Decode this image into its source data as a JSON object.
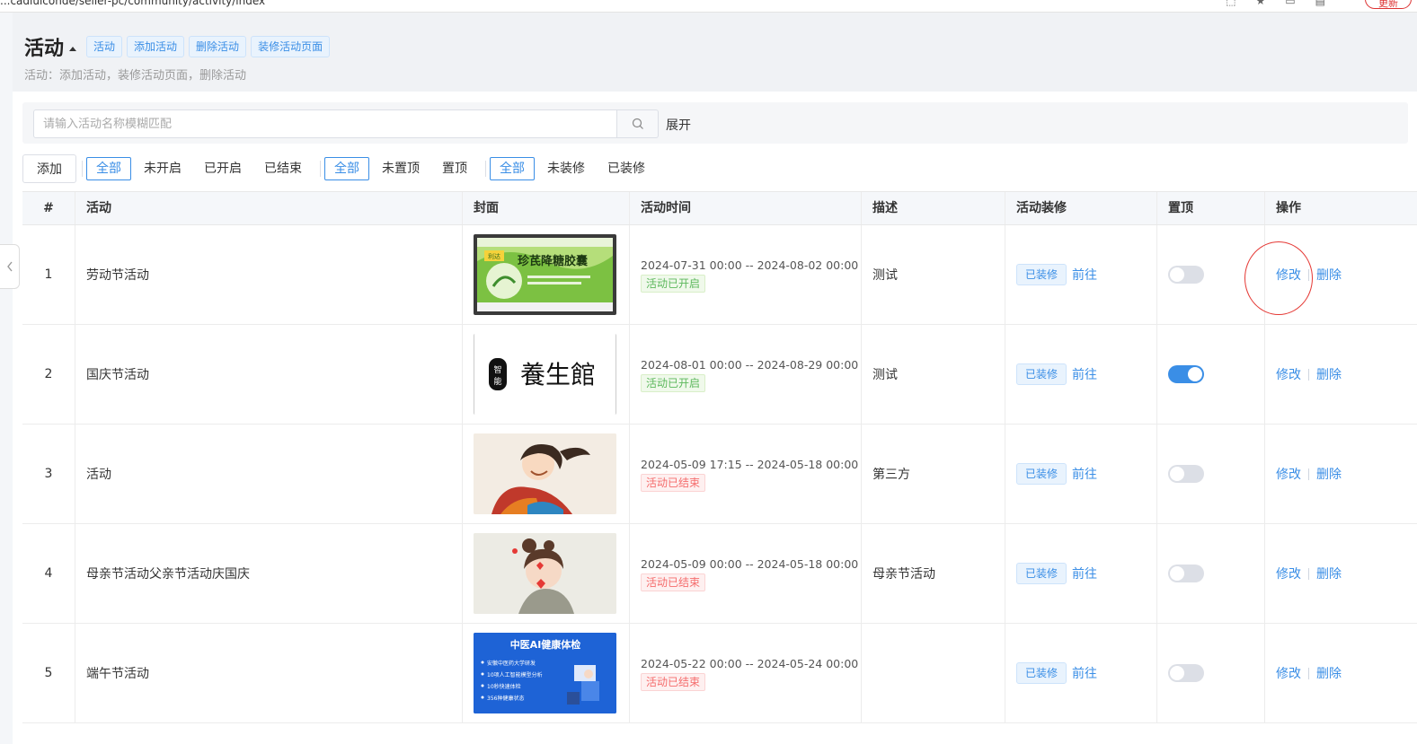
{
  "browser": {
    "url": "...cadiuiconde/seller-pc/community/activity/index",
    "update_label": "更新"
  },
  "header": {
    "title": "活动",
    "tags": [
      "活动",
      "添加活动",
      "删除活动",
      "装修活动页面"
    ],
    "subtitle": "活动：添加活动，装修活动页面，删除活动"
  },
  "search": {
    "placeholder": "请输入活动名称模糊匹配",
    "value": "",
    "expand_label": "展开"
  },
  "filters": {
    "add_label": "添加",
    "status_group": [
      "全部",
      "未开启",
      "已开启",
      "已结束"
    ],
    "top_group": [
      "全部",
      "未置顶",
      "置顶"
    ],
    "deco_group": [
      "全部",
      "未装修",
      "已装修"
    ]
  },
  "table": {
    "headers": [
      "#",
      "活动",
      "封面",
      "活动时间",
      "描述",
      "活动装修",
      "置顶",
      "操作"
    ],
    "rows": [
      {
        "index": "1",
        "name": "劳动节活动",
        "cover": "medicine-box",
        "time": "2024-07-31 00:00 -- 2024-08-02 00:00",
        "status": "活动已开启",
        "status_type": "on",
        "desc": "测试",
        "deco_tag": "已装修",
        "goto": "前往",
        "pinned": false,
        "edit": "修改",
        "delete": "删除"
      },
      {
        "index": "2",
        "name": "国庆节活动",
        "cover": "calligraphy-logo",
        "time": "2024-08-01 00:00 -- 2024-08-29 00:00",
        "status": "活动已开启",
        "status_type": "on",
        "desc": "测试",
        "deco_tag": "已装修",
        "goto": "前往",
        "pinned": true,
        "edit": "修改",
        "delete": "删除"
      },
      {
        "index": "3",
        "name": "活动",
        "cover": "girl-illustration",
        "time": "2024-05-09 17:15 -- 2024-05-18 00:00",
        "status": "活动已结束",
        "status_type": "off",
        "desc": "第三方",
        "deco_tag": "已装修",
        "goto": "前往",
        "pinned": false,
        "edit": "修改",
        "delete": "删除"
      },
      {
        "index": "4",
        "name": "母亲节活动父亲节活动庆国庆",
        "cover": "girl-hearts",
        "time": "2024-05-09 00:00 -- 2024-05-18 00:00",
        "status": "活动已结束",
        "status_type": "off",
        "desc": "母亲节活动",
        "deco_tag": "已装修",
        "goto": "前往",
        "pinned": false,
        "edit": "修改",
        "delete": "删除"
      },
      {
        "index": "5",
        "name": "端午节活动",
        "cover": "tcm-banner",
        "time": "2024-05-22 00:00 -- 2024-05-24 00:00",
        "status": "活动已结束",
        "status_type": "off",
        "desc": "",
        "deco_tag": "已装修",
        "goto": "前往",
        "pinned": false,
        "edit": "修改",
        "delete": "删除"
      }
    ]
  },
  "covers": {
    "medicine": {
      "brand": "利达",
      "title": "珍芪降糖胶囊"
    },
    "calligraphy": {
      "seal": "智能",
      "text": "養生館"
    },
    "tcm": {
      "title": "中医AI健康体检",
      "lines": [
        "安徽中医药大学研发",
        "10项人工智能模型分析",
        "10秒快速体检",
        "356种健康状态"
      ]
    }
  },
  "colors": {
    "accent": "#3a8ee6",
    "success": "#5cb85c",
    "danger": "#f56c6c",
    "annotation": "#e53935"
  }
}
